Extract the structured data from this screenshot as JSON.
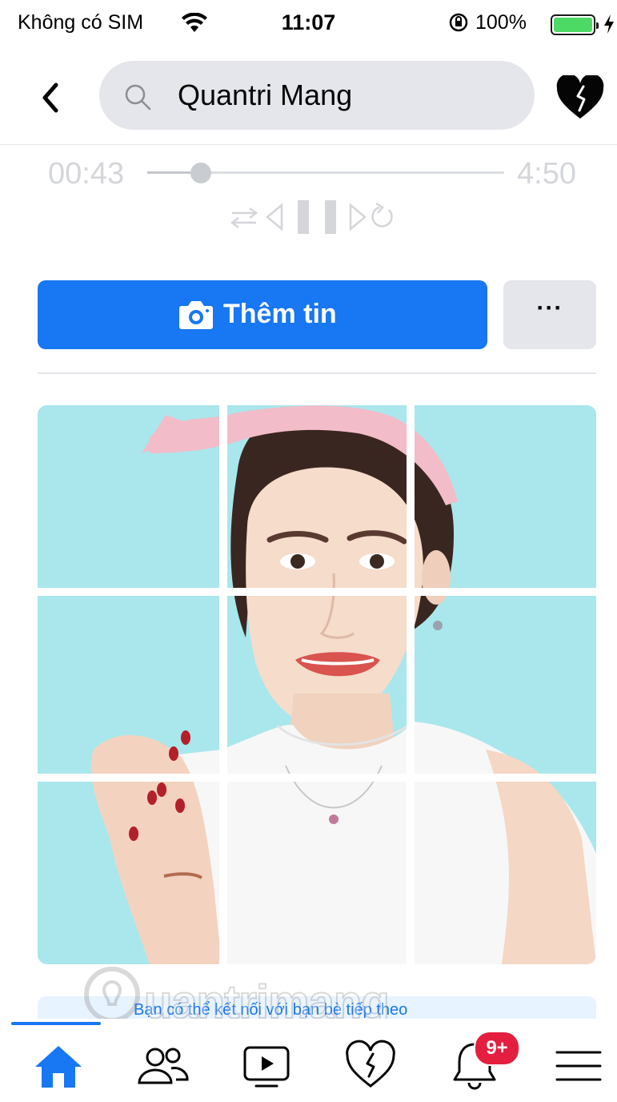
{
  "status_bar": {
    "carrier": "Không có SIM",
    "time": "11:07",
    "battery_percent": "100%",
    "battery_level": 1.0,
    "icons": [
      "wifi-icon",
      "orientation-lock-icon",
      "battery-icon",
      "charging-bolt-icon"
    ]
  },
  "header": {
    "search_text": "Quantri Mang",
    "back_icon": "chevron-left-icon",
    "search_icon": "search-icon",
    "favorite_icon": "heart-icon"
  },
  "music_player": {
    "elapsed": "00:43",
    "duration": "4:50",
    "progress": 0.15,
    "controls": [
      "shuffle-icon",
      "previous-icon",
      "pause-icon",
      "next-icon",
      "repeat-icon"
    ]
  },
  "actions": {
    "add_story_label": "Thêm tin",
    "add_story_icon": "camera-icon",
    "more_label": "···"
  },
  "photo_grid": {
    "rows": 3,
    "columns": 3,
    "description_icon": "profile-photo"
  },
  "story_card": {
    "text": "Bạn có thể kết nối với bạn bè tiếp theo"
  },
  "watermark": {
    "text": "uantrimang"
  },
  "bottom_nav": {
    "tabs": [
      {
        "icon": "home-icon",
        "active": true
      },
      {
        "icon": "friends-icon",
        "active": false
      },
      {
        "icon": "watch-icon",
        "active": false
      },
      {
        "icon": "dating-heart-icon",
        "active": false
      },
      {
        "icon": "notifications-bell-icon",
        "active": false
      },
      {
        "icon": "menu-icon",
        "active": false
      }
    ],
    "notification_badge": "9+"
  },
  "colors": {
    "accent": "#1877f2",
    "button_gray": "#e4e6eb",
    "badge_red": "#e41e3f",
    "photo_background": "#a9e7ec"
  }
}
